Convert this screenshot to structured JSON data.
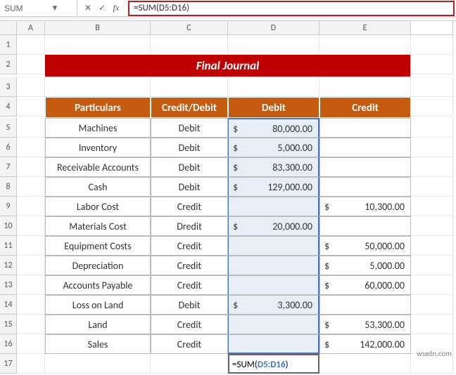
{
  "namebox": {
    "value": "SUM"
  },
  "formula_bar": {
    "formula": "=SUM(D5:D16)"
  },
  "fx": {
    "cancel": "✕",
    "enter": "✓",
    "fx": "fx"
  },
  "cols": [
    "A",
    "B",
    "C",
    "D",
    "E"
  ],
  "rows": [
    "1",
    "2",
    "3",
    "4",
    "5",
    "6",
    "7",
    "8",
    "9",
    "10",
    "11",
    "12",
    "13",
    "14",
    "15",
    "16",
    "17"
  ],
  "title": "Final Journal",
  "headers": {
    "particulars": "Particulars",
    "cd": "Credit/Debit",
    "debit": "Debit",
    "credit": "Credit"
  },
  "table": [
    {
      "p": "Machines",
      "cd": "Debit",
      "debit": "80,000.00",
      "credit": ""
    },
    {
      "p": "Inventory",
      "cd": "Debit",
      "debit": "5,000.00",
      "credit": ""
    },
    {
      "p": "Receivable Accounts",
      "cd": "Debit",
      "debit": "83,300.00",
      "credit": ""
    },
    {
      "p": "Cash",
      "cd": "Debit",
      "debit": "129,000.00",
      "credit": ""
    },
    {
      "p": "Labor Cost",
      "cd": "Credit",
      "debit": "",
      "credit": "10,300.00"
    },
    {
      "p": "Materials Cost",
      "cd": "Dredit",
      "debit": "20,000.00",
      "credit": ""
    },
    {
      "p": "Equipment Costs",
      "cd": "Credit",
      "debit": "",
      "credit": "50,000.00"
    },
    {
      "p": "Depreciation",
      "cd": "Credit",
      "debit": "",
      "credit": "5,000.00"
    },
    {
      "p": "Accounts Payable",
      "cd": "Credit",
      "debit": "",
      "credit": "60,000.00"
    },
    {
      "p": "Loss on Land",
      "cd": "Debit",
      "debit": "3,300.00",
      "credit": ""
    },
    {
      "p": "Land",
      "cd": "Credit",
      "debit": "",
      "credit": "53,300.00"
    },
    {
      "p": "Sales",
      "cd": "Credit",
      "debit": "",
      "credit": "142,000.00"
    }
  ],
  "sum_cell": {
    "prefix": "=SUM(",
    "range": "D5:D16",
    "suffix": ")"
  },
  "currency": "$",
  "watermark": "wsxdn.com"
}
